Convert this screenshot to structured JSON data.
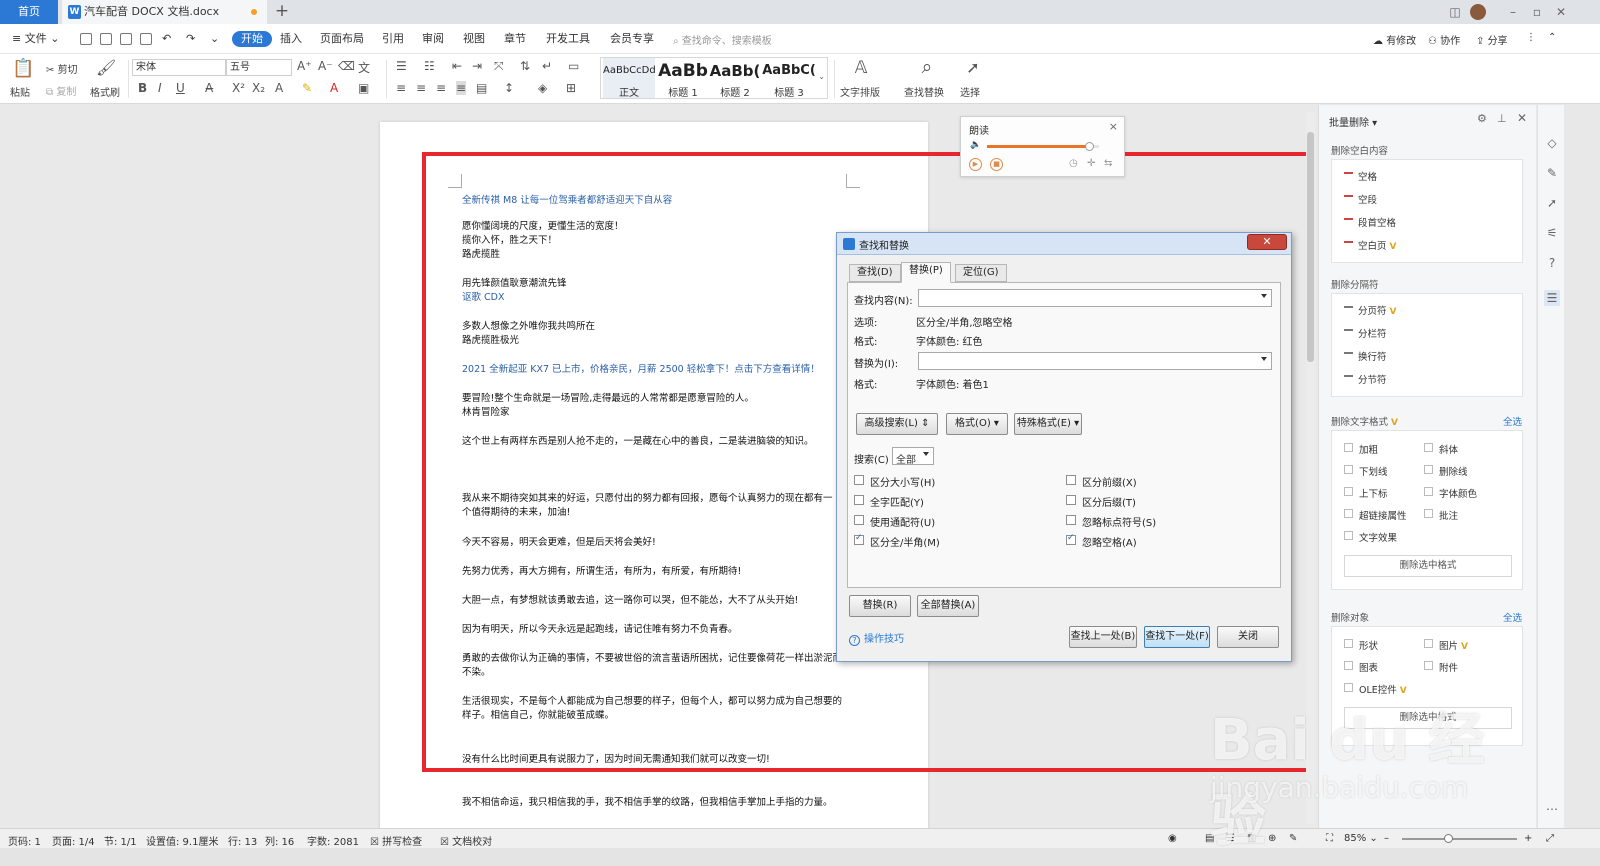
{
  "tabs": {
    "home": "首页",
    "doc": "汽车配音 DOCX 文档.docx",
    "add": "+"
  },
  "menu": {
    "file": "文件",
    "items": [
      "开始",
      "插入",
      "页面布局",
      "引用",
      "审阅",
      "视图",
      "章节",
      "开发工具",
      "会员专享"
    ],
    "search_placeholder": "查找命令、搜索模板",
    "has_changes": "有修改",
    "collab": "协作",
    "share": "分享"
  },
  "ribbon": {
    "paste": "粘贴",
    "cut": "剪切",
    "copy": "复制",
    "format_painter": "格式刷",
    "font_name": "宋体",
    "font_size": "五号",
    "styles": [
      {
        "sample": "AaBbCcDd",
        "name": "正文"
      },
      {
        "sample": "AaBb",
        "name": "标题 1"
      },
      {
        "sample": "AaBb(",
        "name": "标题 2"
      },
      {
        "sample": "AaBbC(",
        "name": "标题 3"
      }
    ],
    "text_layout": "文字排版",
    "find_replace": "查找替换",
    "select": "选择"
  },
  "document": {
    "lines": [
      {
        "text": "全新传祺 M8 让每一位驾乘者都舒适迎天下自从容",
        "blue": true
      },
      {
        "text": "愿你懂阔境的尺度，更懂生活的宽度！",
        "blue": false
      },
      {
        "text": "揽你入怀，胜之天下！",
        "blue": false
      },
      {
        "text": "路虎揽胜",
        "blue": false
      },
      {
        "text": "用先锋颜值耿意潮流先锋",
        "blue": false
      },
      {
        "text": "讴歌 CDX",
        "blue": true
      },
      {
        "text": "多数人想像之外唯你我共鸣所在",
        "blue": false
      },
      {
        "text": "路虎揽胜极光",
        "blue": false
      },
      {
        "text": "2021 全新起亚 KX7 已上市，价格亲民，月薪 2500 轻松拿下！点击下方查看详情！",
        "blue": true
      },
      {
        "text": "要冒险!整个生命就是一场冒险,走得最远的人常常都是愿意冒险的人。",
        "blue": false
      },
      {
        "text": "林肯冒险家",
        "blue": false
      },
      {
        "text": "这个世上有两样东西是别人抢不走的，一是藏在心中的善良，二是装进脑袋的知识。",
        "blue": false
      },
      {
        "text": "我从来不期待突如其来的好运，只愿付出的努力都有回报，愿每个认真努力的现在都有一",
        "blue": false
      },
      {
        "text": "个值得期待的未来，加油!",
        "blue": false
      },
      {
        "text": "今天不容易，明天会更难，但是后天将会美好!",
        "blue": false
      },
      {
        "text": "先努力优秀，再大方拥有，所谓生活，有所为，有所爱，有所期待!",
        "blue": false
      },
      {
        "text": "大胆一点，有梦想就该勇敢去追，这一路你可以哭，但不能怂，大不了从头开始!",
        "blue": false
      },
      {
        "text": "因为有明天，所以今天永远是起跑线，请记住唯有努力不负青春。",
        "blue": false
      },
      {
        "text": "勇敢的去做你认为正确的事情，不要被世俗的流言蜚语所困扰，记住要像荷花一样出淤泥而",
        "blue": false
      },
      {
        "text": "不染。",
        "blue": false
      },
      {
        "text": "生活很现实，不是每个人都能成为自己想要的样子，但每个人，都可以努力成为自己想要的",
        "blue": false
      },
      {
        "text": "样子。相信自己，你就能破茧成蝶。",
        "blue": false
      },
      {
        "text": "没有什么比时间更具有说服力了，因为时间无需通知我们就可以改变一切!",
        "blue": false
      },
      {
        "text": "我不相信命运，我只相信我的手，我不相信手掌的纹路，但我相信手掌加上手指的力量。",
        "blue": false
      }
    ]
  },
  "read_panel": {
    "title": "朗读",
    "close": "×",
    "volume": 0.92
  },
  "dialog": {
    "title": "查找和替换",
    "close": "✕",
    "tabs": [
      "查找(D)",
      "替换(P)",
      "定位(G)"
    ],
    "find_label": "查找内容(N):",
    "find_value": "",
    "options_label": "选项:",
    "options_value": "区分全/半角,忽略空格",
    "format_label": "格式:",
    "find_format": "字体颜色: 红色",
    "replace_label": "替换为(I):",
    "replace_value": "",
    "replace_format": "字体颜色: 着色1",
    "advanced": "高级搜索(L)",
    "format_btn": "格式(O)",
    "special_btn": "特殊格式(E)",
    "search_label": "搜索(C)",
    "search_scope": "全部",
    "checks": [
      {
        "label": "区分大小写(H)",
        "checked": false
      },
      {
        "label": "全字匹配(Y)",
        "checked": false
      },
      {
        "label": "使用通配符(U)",
        "checked": false
      },
      {
        "label": "区分全/半角(M)",
        "checked": true
      },
      {
        "label": "区分前缀(X)",
        "checked": false
      },
      {
        "label": "区分后缀(T)",
        "checked": false
      },
      {
        "label": "忽略标点符号(S)",
        "checked": false
      },
      {
        "label": "忽略空格(A)",
        "checked": true
      }
    ],
    "replace_btn": "替换(R)",
    "replace_all_btn": "全部替换(A)",
    "tips": "操作技巧",
    "find_prev": "查找上一处(B)",
    "find_next": "查找下一处(F)",
    "close_btn": "关闭"
  },
  "taskpane": {
    "title": "批量删除",
    "sec1": "删除空白内容",
    "sec1_items": [
      "空格",
      "空段",
      "段首空格",
      "空白页"
    ],
    "sec2": "删除分隔符",
    "sec2_items": [
      "分页符",
      "分栏符",
      "换行符",
      "分节符"
    ],
    "sec3": "删除文字格式",
    "select_all": "全选",
    "fmt_left": [
      "加粗",
      "下划线",
      "上下标",
      "超链接属性",
      "文字效果"
    ],
    "fmt_right": [
      "斜体",
      "删除线",
      "字体颜色",
      "批注"
    ],
    "delete_selected_fmt": "删除选中格式",
    "sec4": "删除对象",
    "obj_left": [
      "形状",
      "图表",
      "OLE控件"
    ],
    "obj_right": [
      "图片",
      "附件"
    ],
    "vip_mark": "V"
  },
  "status": {
    "page_num": "页码: 1",
    "page": "页面: 1/4",
    "section": "节: 1/1",
    "setting": "设置值: 9.1厘米",
    "row": "行: 13",
    "col": "列: 16",
    "words": "字数: 2081",
    "spell": "拼写检查",
    "proof": "文档校对",
    "zoom": "85%"
  },
  "watermark": {
    "logo": "Bai du 经验",
    "url": "jingyan.baidu.com"
  },
  "colors": {
    "accent": "#2b79d4",
    "highlight_frame": "#e8262e",
    "vip": "#e0a41d"
  }
}
